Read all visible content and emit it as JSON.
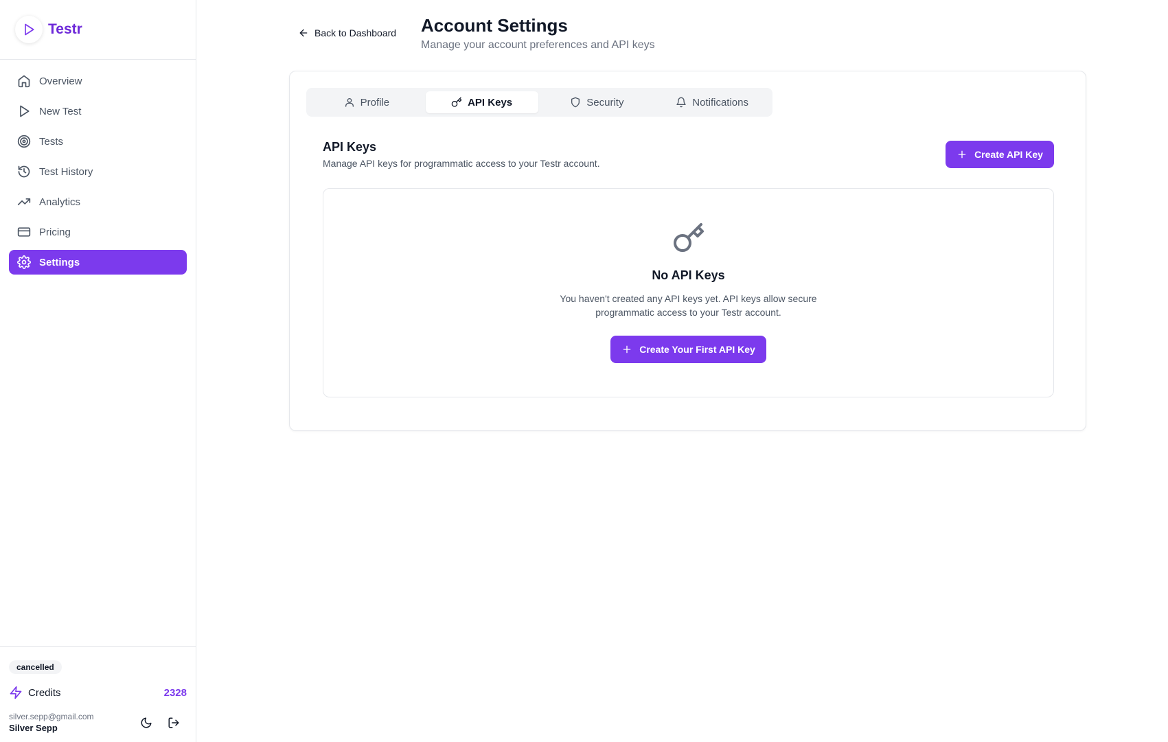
{
  "brand": {
    "name": "Testr"
  },
  "nav": {
    "items": [
      {
        "label": "Overview",
        "icon": "home-icon"
      },
      {
        "label": "New Test",
        "icon": "play-icon"
      },
      {
        "label": "Tests",
        "icon": "target-icon"
      },
      {
        "label": "Test History",
        "icon": "history-icon"
      },
      {
        "label": "Analytics",
        "icon": "trending-up-icon"
      },
      {
        "label": "Pricing",
        "icon": "credit-card-icon"
      },
      {
        "label": "Settings",
        "icon": "gear-icon",
        "active": true
      }
    ]
  },
  "footer": {
    "status_badge": "cancelled",
    "credits_label": "Credits",
    "credits_value": "2328",
    "user_email": "silver.sepp@gmail.com",
    "user_name": "Silver Sepp"
  },
  "header": {
    "back_label": "Back to Dashboard",
    "title": "Account Settings",
    "subtitle": "Manage your account preferences and API keys"
  },
  "tabs": [
    {
      "label": "Profile",
      "icon": "user-icon"
    },
    {
      "label": "API Keys",
      "icon": "key-icon",
      "active": true
    },
    {
      "label": "Security",
      "icon": "shield-icon"
    },
    {
      "label": "Notifications",
      "icon": "bell-icon"
    }
  ],
  "api_keys": {
    "title": "API Keys",
    "description": "Manage API keys for programmatic access to your Testr account.",
    "create_label": "Create API Key",
    "empty_title": "No API Keys",
    "empty_desc_line1": "You haven't created any API keys yet. API keys allow secure",
    "empty_desc_line2": "programmatic access to your Testr account.",
    "first_key_label": "Create Your First API Key"
  },
  "colors": {
    "accent": "#7c3aed",
    "brand_text": "#6d28d9",
    "border": "#e5e7eb",
    "muted_text": "#6b7280"
  }
}
